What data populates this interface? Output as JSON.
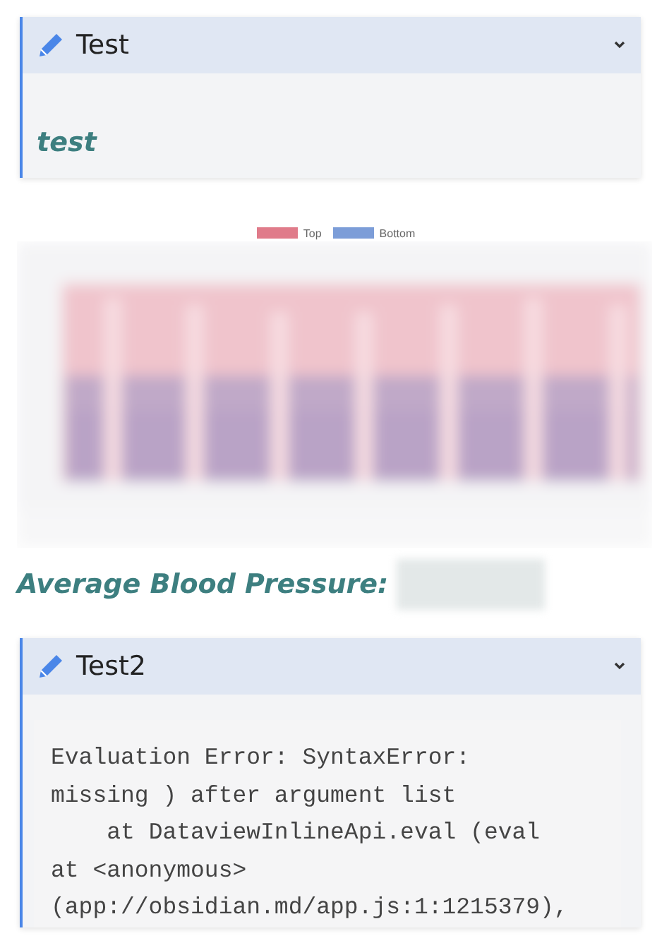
{
  "blocks": [
    {
      "kind": "callout",
      "title": "Test",
      "collapsed": false,
      "content": {
        "kind": "heading",
        "text": "test"
      }
    },
    {
      "kind": "chart",
      "legend": [
        {
          "label": "Top",
          "color": "#e07b8a"
        },
        {
          "label": "Bottom",
          "color": "#7c9dd8"
        }
      ]
    },
    {
      "kind": "heading",
      "text": "Average Blood Pressure:",
      "redacted": true
    },
    {
      "kind": "callout",
      "title": "Test2",
      "collapsed": false,
      "content": {
        "kind": "code",
        "text": "Evaluation Error: SyntaxError:\nmissing ) after argument list\n    at DataviewInlineApi.eval (eval\nat <anonymous>\n(app://obsidian.md/app.js:1:1215379),"
      }
    }
  ]
}
